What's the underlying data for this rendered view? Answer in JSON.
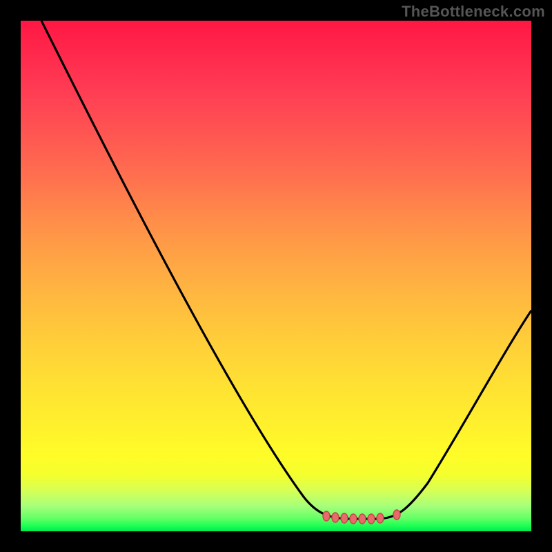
{
  "watermark": "TheBottleneck.com",
  "colors": {
    "background": "#000000",
    "curve_stroke": "#000000",
    "marker_fill": "#e86a6a",
    "marker_stroke": "#c54747"
  },
  "chart_data": {
    "type": "line",
    "title": "",
    "xlabel": "",
    "ylabel": "",
    "xlim": [
      0,
      100
    ],
    "ylim": [
      0,
      100
    ],
    "note": "Values estimated from pixels; plot has no axis ticks or labels. Vertical axis inverted so 0 = bottom (green/good), 100 = top (red/bad).",
    "series": [
      {
        "name": "left-branch",
        "x": [
          4,
          10,
          20,
          30,
          40,
          50,
          56,
          60,
          62,
          65,
          70
        ],
        "y": [
          100,
          90,
          73,
          56,
          39,
          22,
          11,
          5,
          3,
          2,
          2
        ]
      },
      {
        "name": "right-branch",
        "x": [
          70,
          73,
          76,
          80,
          85,
          90,
          95,
          100
        ],
        "y": [
          2,
          2.5,
          4,
          8,
          15,
          24,
          34,
          44
        ]
      }
    ],
    "marker_band": {
      "name": "optimal-range",
      "y": 2.5,
      "x_start": 60,
      "x_end": 74,
      "points_x": [
        60,
        62,
        64,
        66,
        68,
        70,
        72,
        74
      ]
    },
    "gradient_meaning": "top=red (severe bottleneck), bottom=green (balanced)"
  }
}
